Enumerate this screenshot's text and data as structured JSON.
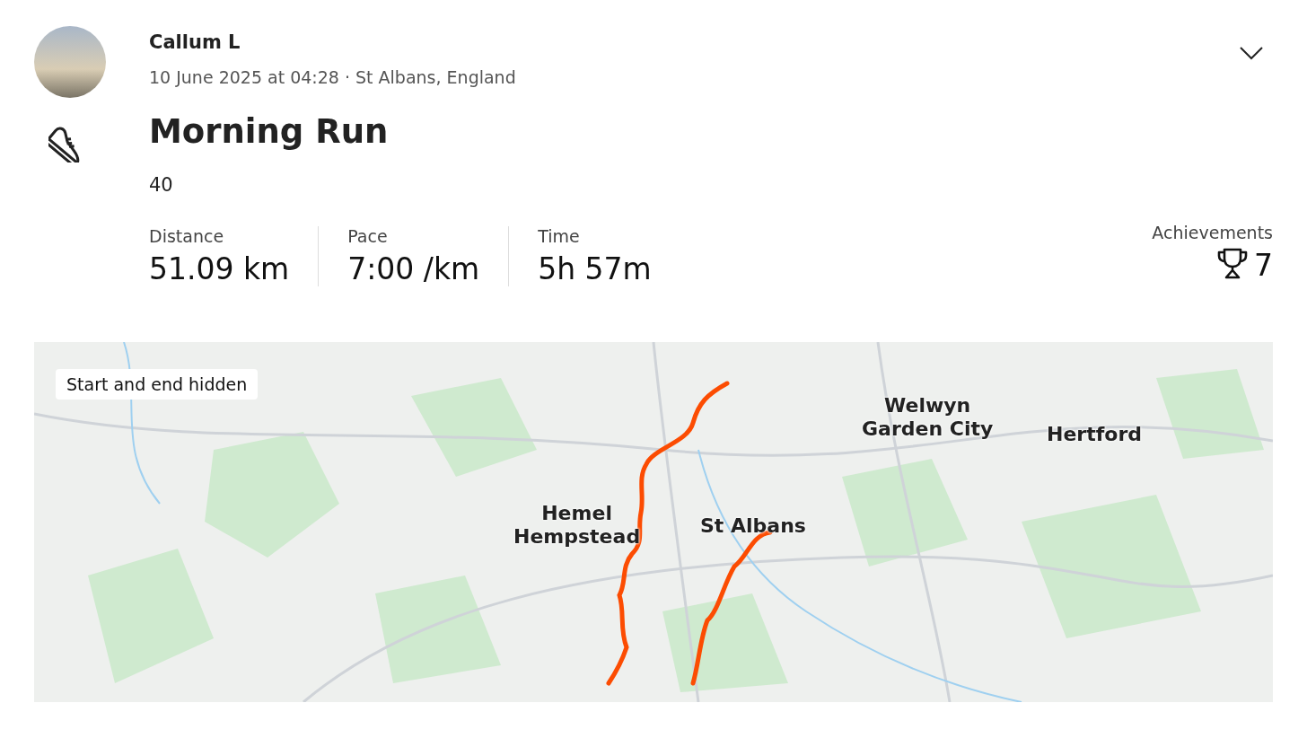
{
  "athlete": {
    "name": "Callum L",
    "meta": "10 June 2025 at 04:28 · St Albans, England"
  },
  "activity": {
    "title": "Morning Run",
    "description": "40"
  },
  "stats": [
    {
      "label": "Distance",
      "value": "51.09 km"
    },
    {
      "label": "Pace",
      "value": "7:00 /km"
    },
    {
      "label": "Time",
      "value": "5h 57m"
    }
  ],
  "achievements": {
    "label": "Achievements",
    "count": "7"
  },
  "map": {
    "notice": "Start and end hidden",
    "places": [
      "Welwyn\nGarden City",
      "Hertford",
      "Hemel\nHempstead",
      "St Albans"
    ]
  }
}
